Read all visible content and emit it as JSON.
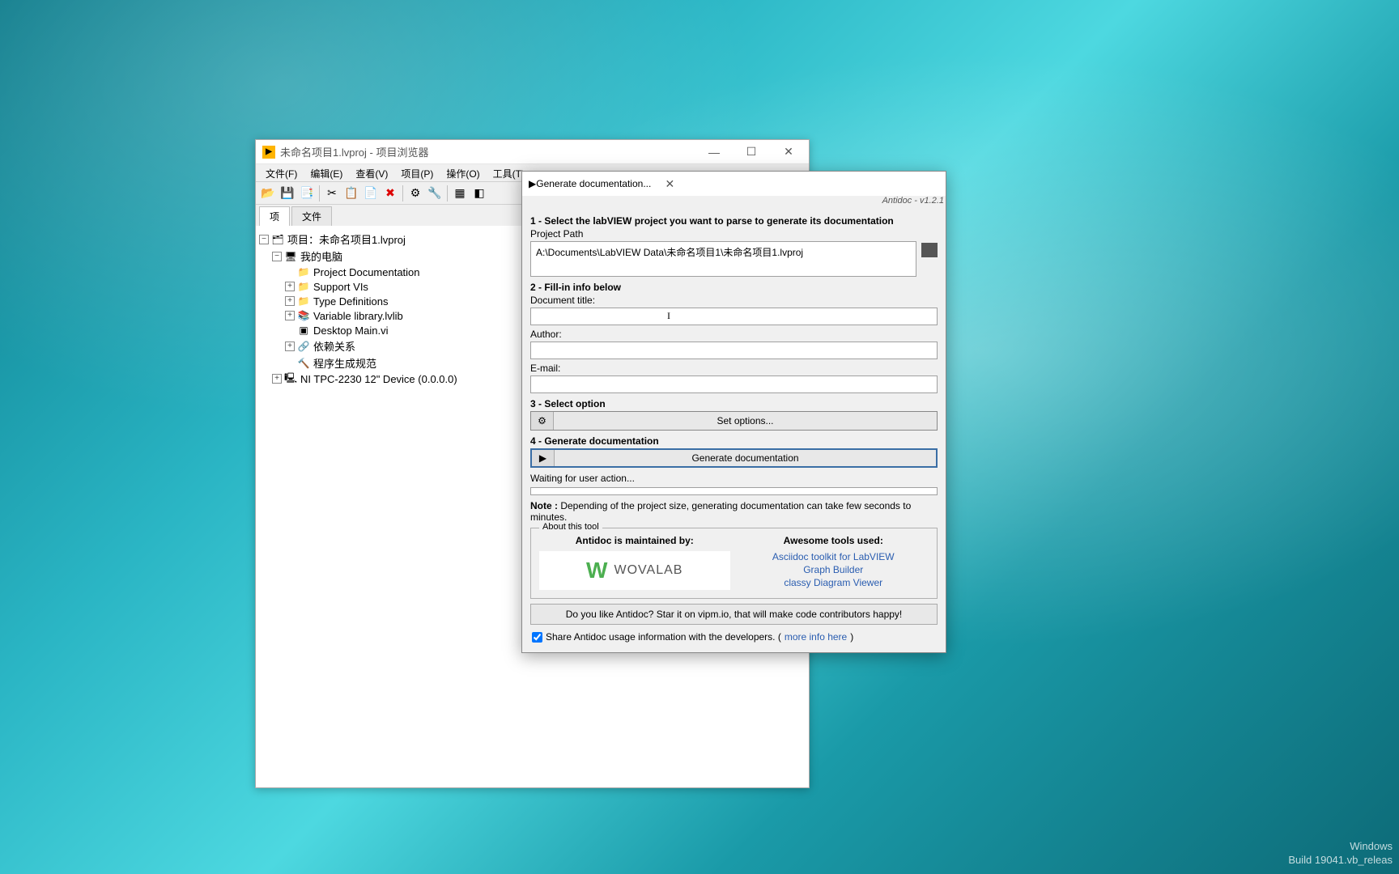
{
  "projectExplorer": {
    "title": "未命名项目1.lvproj - 项目浏览器",
    "menu": [
      "文件(F)",
      "编辑(E)",
      "查看(V)",
      "项目(P)",
      "操作(O)",
      "工具(T)"
    ],
    "tabs": {
      "tab1": "项",
      "tab2": "文件"
    },
    "tree": {
      "root": "项目：未命名项目1.lvproj",
      "mypc": "我的电脑",
      "items": [
        "Project Documentation",
        "Support VIs",
        "Type Definitions",
        "Variable library.lvlib",
        "Desktop Main.vi",
        "依赖关系",
        "程序生成规范"
      ],
      "device": "NI TPC-2230 12\" Device (0.0.0.0)"
    }
  },
  "antidoc": {
    "title": "Generate documentation...",
    "version": "Antidoc - v1.2.1",
    "step1": "1 - Select the labVIEW project you want to  parse to generate its documentation",
    "projectPathLabel": "Project Path",
    "projectPath": "A:\\Documents\\LabVIEW Data\\未命名项目1\\未命名项目1.lvproj",
    "step2": "2 - Fill-in info below",
    "docTitleLabel": "Document title:",
    "docTitle": "",
    "authorLabel": "Author:",
    "author": "",
    "emailLabel": "E-mail:",
    "email": "",
    "step3": "3 - Select option",
    "setOptionsBtn": "Set options...",
    "step4": "4 - Generate documentation",
    "generateBtn": "Generate documentation",
    "status": "Waiting for user action...",
    "noteLabel": "Note :",
    "noteText": " Depending of the project size, generating documentation can take few seconds to minutes.",
    "aboutLegend": "About this tool",
    "maintainedBy": "Antidoc is maintained by:",
    "wovalab": "WOVALAB",
    "toolsUsed": "Awesome tools used:",
    "links": [
      "Asciidoc toolkit for LabVIEW",
      "Graph Builder",
      "classy Diagram Viewer"
    ],
    "starText": "Do you like Antidoc? Star it on vipm.io, that will make code contributors happy!",
    "shareText": "Share Antidoc usage information with the developers.   (",
    "moreInfo": "more info here",
    "shareClose": ")"
  },
  "watermark": {
    "line1": "Windows",
    "line2": "Build 19041.vb_releas"
  }
}
